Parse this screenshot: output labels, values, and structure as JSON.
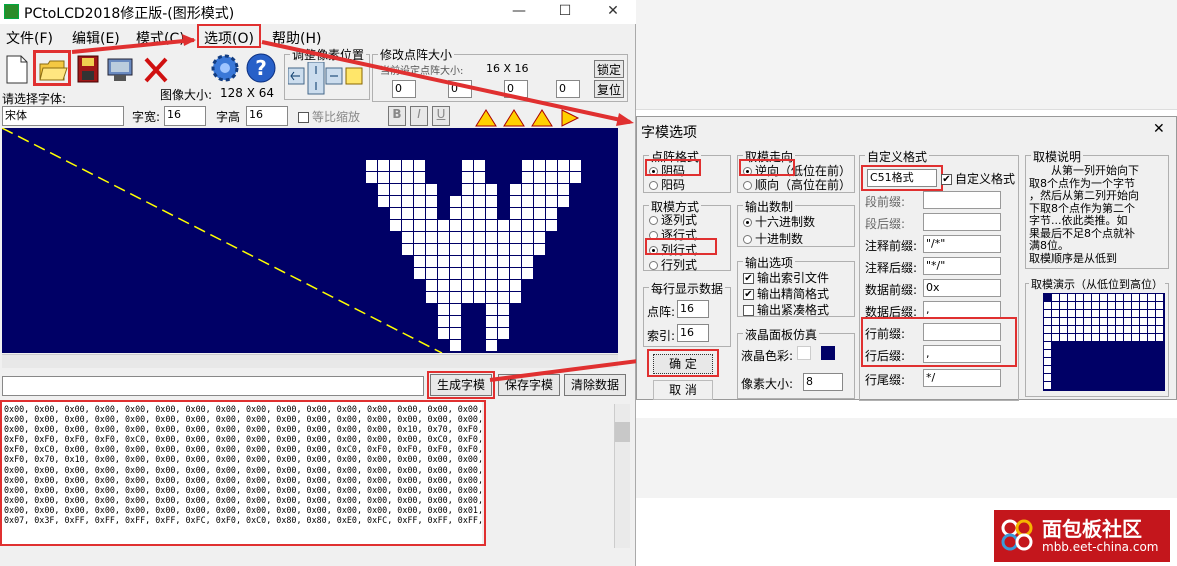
{
  "main_window": {
    "title": "PCtoLCD2018修正版-(图形模式)",
    "menu": [
      "文件(F)",
      "编辑(E)",
      "模式(C)",
      "选项(O)",
      "帮助(H)"
    ],
    "toolbar": {
      "icons": [
        "new-file-icon",
        "open-folder-icon",
        "save-disk-icon",
        "settings-icon",
        "delete-icon",
        "gear-icon",
        "help-icon"
      ]
    },
    "adjust_group_label": "调整像素位置",
    "resize_group_label": "修改点阵大小",
    "current_matrix_label": "当前设定点阵大小:",
    "current_matrix_value": "16 X 16",
    "lock_button": "锁定",
    "reset_button": "复位",
    "spin_values": [
      "0",
      "0",
      "0",
      "0"
    ],
    "font_label": "请选择字体:",
    "image_size_label": "图像大小:",
    "image_size_value": "128 X 64",
    "font_value": "宋体",
    "char_width_label": "字宽:",
    "char_width_value": "16",
    "char_height_label": "字高",
    "char_height_value": "16",
    "proportional_label": "等比缩放",
    "style_buttons": [
      "B",
      "I",
      "U"
    ],
    "generate_button": "生成字模",
    "save_button": "保存字模",
    "clear_button": "清除数据",
    "hex_lines": [
      "0x00, 0x00, 0x00, 0x00, 0x00, 0x00, 0x00, 0x00, 0x00, 0x00, 0x00, 0x00, 0x00, 0x00, 0x00, 0x00,",
      "0x00, 0x00, 0x00, 0x00, 0x00, 0x00, 0x00, 0x00, 0x00, 0x00, 0x00, 0x00, 0x00, 0x00, 0x00, 0x00,",
      "0x00, 0x00, 0x00, 0x00, 0x00, 0x00, 0x00, 0x00, 0x00, 0x00, 0x00, 0x00, 0x00, 0x10, 0x70, 0xF0,",
      "0xF0, 0xF0, 0xF0, 0xF0, 0xC0, 0x00, 0x00, 0x00, 0x00, 0x00, 0x00, 0x00, 0x00, 0x00, 0xC0, 0xF0,",
      "0xF0, 0xC0, 0x00, 0x00, 0x00, 0x00, 0x00, 0x00, 0x00, 0x00, 0x00, 0xC0, 0xF0, 0xF0, 0xF0, 0xF0,",
      "0xF0, 0x70, 0x10, 0x00, 0x00, 0x00, 0x00, 0x00, 0x00, 0x00, 0x00, 0x00, 0x00, 0x00, 0x00, 0x00,",
      "0x00, 0x00, 0x00, 0x00, 0x00, 0x00, 0x00, 0x00, 0x00, 0x00, 0x00, 0x00, 0x00, 0x00, 0x00, 0x00,",
      "0x00, 0x00, 0x00, 0x00, 0x00, 0x00, 0x00, 0x00, 0x00, 0x00, 0x00, 0x00, 0x00, 0x00, 0x00, 0x00,",
      "0x00, 0x00, 0x00, 0x00, 0x00, 0x00, 0x00, 0x00, 0x00, 0x00, 0x00, 0x00, 0x00, 0x00, 0x00, 0x00,",
      "0x00, 0x00, 0x00, 0x00, 0x00, 0x00, 0x00, 0x00, 0x00, 0x00, 0x00, 0x00, 0x00, 0x00, 0x00, 0x00,",
      "0x00, 0x00, 0x00, 0x00, 0x00, 0x00, 0x00, 0x00, 0x00, 0x00, 0x00, 0x00, 0x00, 0x00, 0x00, 0x01,",
      "0x07, 0x3F, 0xFF, 0xFF, 0xFF, 0xFF, 0xFC, 0xF0, 0xC0, 0x80, 0x80, 0xE0, 0xFC, 0xFF, 0xFF, 0xFF,"
    ]
  },
  "dialog": {
    "title": "字模选项",
    "dot_format": {
      "label": "点阵格式",
      "options": [
        "阴码",
        "阳码"
      ],
      "selected": 0
    },
    "direction": {
      "label": "取模走向",
      "options": [
        "逆向（低位在前）",
        "顺向（高位在前）"
      ],
      "selected": 0
    },
    "custom_format": {
      "label": "自定义格式",
      "select_value": "C51格式",
      "check_label": "自定义格式"
    },
    "desc": {
      "label": "取模说明",
      "text": [
        "从第一列开始向下",
        "取8个点作为一个字节",
        "，然后从第二列开始向",
        "下取8个点作为第二个",
        "字节...依此类推。如",
        "果最后不足8个点就补",
        "满8位。",
        "取模顺序是从低到"
      ]
    },
    "mode": {
      "label": "取模方式",
      "options": [
        "逐列式",
        "逐行式",
        "列行式",
        "行列式"
      ],
      "selected": 2
    },
    "radix": {
      "label": "输出数制",
      "options": [
        "十六进制数",
        "十进制数"
      ],
      "selected": 0
    },
    "fields": [
      {
        "label": "段前缀:",
        "value": ""
      },
      {
        "label": "段后缀:",
        "value": ""
      },
      {
        "label": "注释前缀:",
        "value": "\"/*\""
      },
      {
        "label": "注释后缀:",
        "value": "\"*/\""
      },
      {
        "label": "数据前缀:",
        "value": "0x"
      },
      {
        "label": "数据后缀:",
        "value": ","
      },
      {
        "label": "行前缀:",
        "value": ""
      },
      {
        "label": "行后缀:",
        "value": ","
      },
      {
        "label": "行尾缀:",
        "value": "*/"
      }
    ],
    "per_line": {
      "label": "每行显示数据",
      "dot_label": "点阵:",
      "dot_value": "16",
      "index_label": "索引:",
      "index_value": "16"
    },
    "output": {
      "label": "输出选项",
      "options": [
        "输出索引文件",
        "输出精简格式",
        "输出紧凑格式"
      ],
      "checked": [
        true,
        true,
        false
      ]
    },
    "lcd": {
      "label": "液晶面板仿真",
      "color_label": "液晶色彩:",
      "pixel_label": "像素大小:",
      "pixel_value": "8",
      "color": "#000066"
    },
    "demo_label": "取模演示（从低位到高位）",
    "ok_button": "确  定",
    "cancel_button": "取  消"
  },
  "watermark": {
    "brand": "面包板社区",
    "url": "mbb.eet-china.com"
  }
}
